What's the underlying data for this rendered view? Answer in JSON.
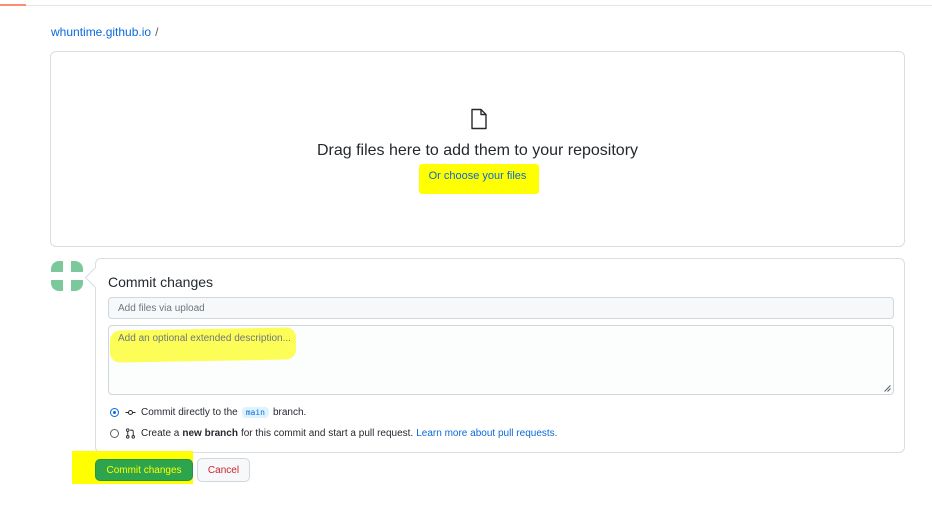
{
  "breadcrumb": {
    "repo": "whuntime.github.io",
    "separator": "/"
  },
  "dropzone": {
    "icon": "file-icon",
    "title": "Drag files here to add them to your repository",
    "choose_link": "Or choose your files"
  },
  "commit": {
    "title": "Commit changes",
    "summary_placeholder": "Add files via upload",
    "description_placeholder": "Add an optional extended description...",
    "options": {
      "direct": {
        "prefix": "Commit directly to the",
        "branch": "main",
        "suffix": "branch.",
        "selected": true
      },
      "new_branch": {
        "prefix": "Create a",
        "bold": "new branch",
        "suffix": "for this commit and start a pull request.",
        "link": "Learn more about pull requests.",
        "selected": false
      }
    }
  },
  "actions": {
    "commit_button": "Commit changes",
    "cancel_button": "Cancel"
  },
  "colors": {
    "link": "#0969da",
    "primary_button": "#2da44e",
    "cancel_text": "#cf222e",
    "highlight": "#ffff00",
    "avatar": "#7bc99a"
  }
}
